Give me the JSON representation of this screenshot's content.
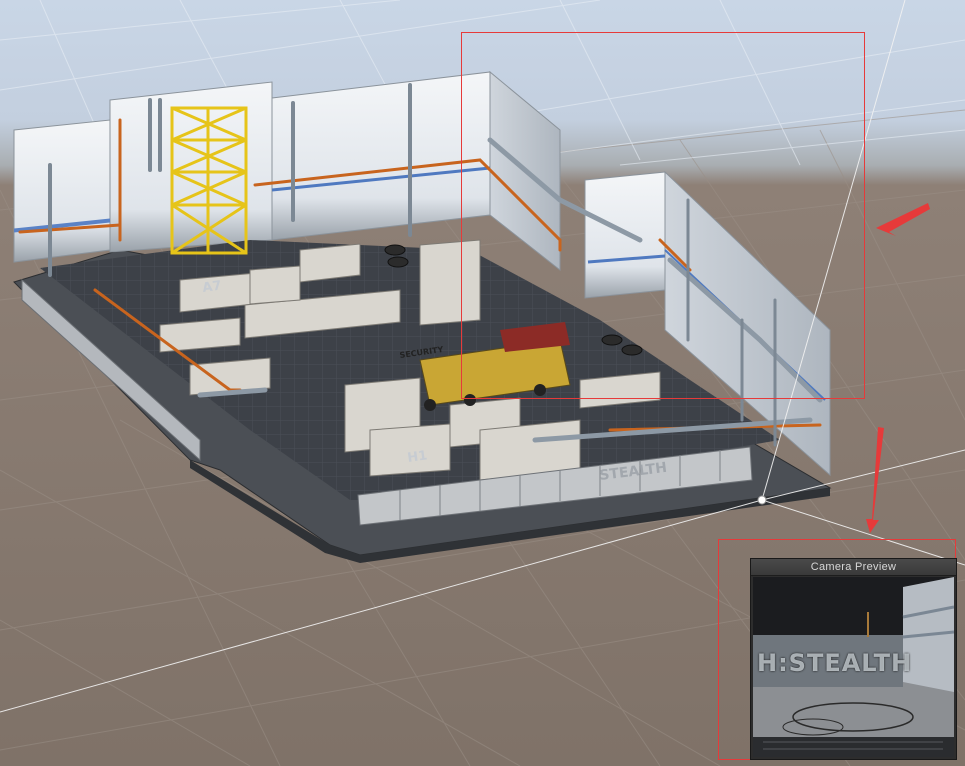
{
  "editor": {
    "view": "scene-view",
    "gizmo": "camera-frustum"
  },
  "scene": {
    "floor_labels": [
      "A7",
      "H1"
    ],
    "signs": [
      "SECURITY",
      "STEALTH"
    ]
  },
  "camera_preview": {
    "title": "Camera Preview",
    "sign_text": "H:STEALTH"
  },
  "annotations": {
    "color": "#e63a3a",
    "arrow_icon": "red-arrow-icon"
  },
  "colors": {
    "ground": "#7f7268",
    "sky": "#c9d6e6",
    "wall": "#e9edf1",
    "pipe_orange": "#c8641e",
    "scaffold": "#e6c419"
  }
}
